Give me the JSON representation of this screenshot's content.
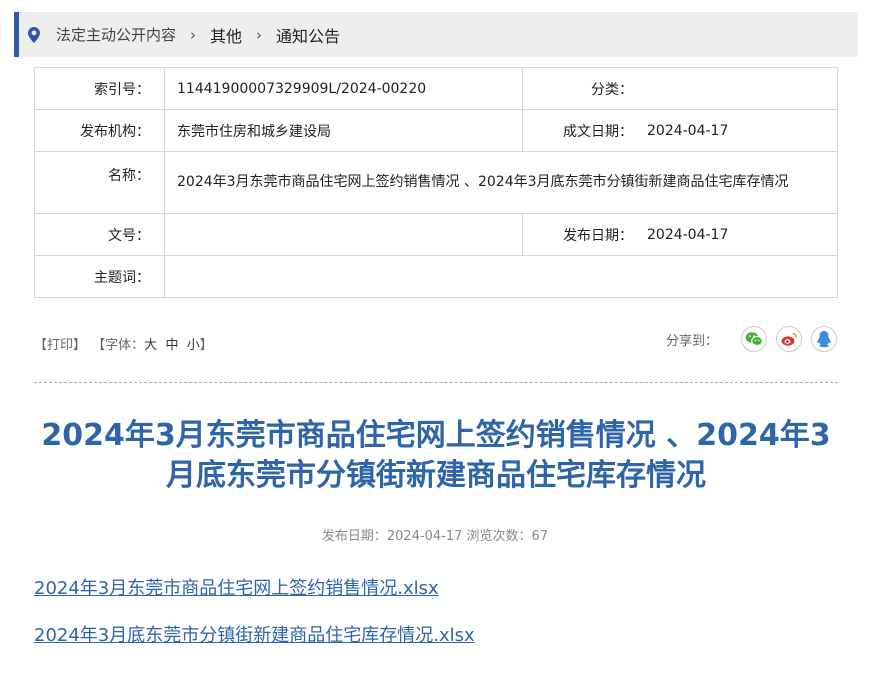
{
  "breadcrumb": {
    "items": [
      "法定主动公开内容",
      "其他",
      "通知公告"
    ],
    "separator": "›"
  },
  "meta": {
    "index_label": "索引号：",
    "index_value": "11441900007329909L/2024-00220",
    "category_label": "分类：",
    "category_value": "",
    "publisher_label": "发布机构：",
    "publisher_value": "东莞市住房和城乡建设局",
    "created_label": "成文日期：",
    "created_value": "2024-04-17",
    "name_label": "名称：",
    "name_value": "2024年3月东莞市商品住宅网上签约销售情况 、2024年3月底东莞市分镇街新建商品住宅库存情况",
    "docno_label": "文号：",
    "docno_value": "",
    "published_label": "发布日期：",
    "published_value": "2024-04-17",
    "keywords_label": "主题词：",
    "keywords_value": ""
  },
  "tools": {
    "print": "【打印】",
    "font_prefix": "【字体：",
    "font_large": "大",
    "font_medium": "中",
    "font_small": "小",
    "font_suffix": "】"
  },
  "share": {
    "label": "分享到：",
    "icons": [
      "wechat-icon",
      "weibo-icon",
      "qq-icon"
    ]
  },
  "article": {
    "title": "2024年3月东莞市商品住宅网上签约销售情况 、2024年3月底东莞市分镇街新建商品住宅库存情况",
    "pubinfo": "发布日期：2024-04-17  浏览次数：67",
    "attachments": [
      "2024年3月东莞市商品住宅网上签约销售情况.xlsx",
      "2024年3月底东莞市分镇街新建商品住宅库存情况.xlsx"
    ]
  },
  "colors": {
    "accent": "#2e64a8",
    "breadcrumb_bar": "#2b5aa6",
    "wechat": "#49b233",
    "weibo": "#e2352e",
    "qq": "#3d8fd6"
  }
}
